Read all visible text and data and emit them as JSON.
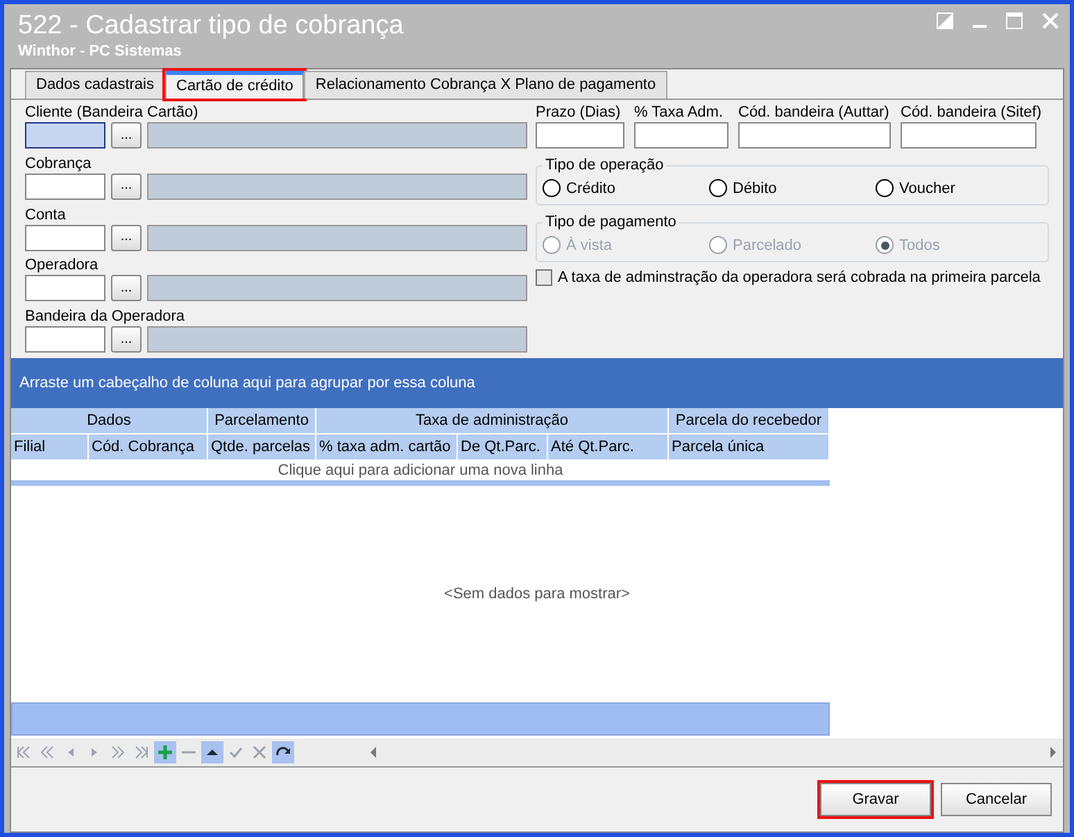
{
  "window": {
    "title": "522 - Cadastrar tipo de cobrança",
    "subtitle": "Winthor - PC Sistemas"
  },
  "tabs": [
    {
      "label": "Dados cadastrais",
      "selected": false,
      "highlighted": false
    },
    {
      "label": "Cartão de crédito",
      "selected": true,
      "highlighted": true
    },
    {
      "label": "Relacionamento Cobrança X Plano de pagamento",
      "selected": false,
      "highlighted": false
    }
  ],
  "lookups": [
    {
      "label": "Cliente (Bandeira Cartão)",
      "button": "...",
      "focused": true
    },
    {
      "label": "Cobrança",
      "button": "...",
      "focused": false
    },
    {
      "label": "Conta",
      "button": "...",
      "focused": false
    },
    {
      "label": "Operadora",
      "button": "...",
      "focused": false
    },
    {
      "label": "Bandeira da Operadora",
      "button": "...",
      "focused": false
    }
  ],
  "fields": [
    {
      "label": "Prazo (Dias)"
    },
    {
      "label": "% Taxa Adm."
    },
    {
      "label": "Cód. bandeira (Auttar)"
    },
    {
      "label": "Cód. bandeira (Sitef)"
    }
  ],
  "radio_groups": [
    {
      "title": "Tipo de operação",
      "disabled": false,
      "options": [
        {
          "label": "Crédito",
          "selected": false
        },
        {
          "label": "Débito",
          "selected": false
        },
        {
          "label": "Voucher",
          "selected": false
        }
      ]
    },
    {
      "title": "Tipo de pagamento",
      "disabled": true,
      "options": [
        {
          "label": "À vista",
          "selected": false
        },
        {
          "label": "Parcelado",
          "selected": false
        },
        {
          "label": "Todos",
          "selected": true
        }
      ]
    }
  ],
  "checkbox": {
    "label": "A taxa de adminstração da operadora será cobrada na primeira parcela",
    "checked": false
  },
  "grid": {
    "group_panel": "Arraste um cabeçalho de coluna aqui para agrupar por essa coluna",
    "bands": [
      {
        "label": "Dados"
      },
      {
        "label": "Parcelamento"
      },
      {
        "label": "Taxa de administração"
      },
      {
        "label": "Parcela do recebedor"
      }
    ],
    "columns": [
      "Filial",
      "Cód. Cobrança",
      "Qtde. parcelas",
      "% taxa adm. cartão",
      "De Qt.Parc.",
      "Até Qt.Parc.",
      "Parcela única"
    ],
    "new_row": "Clique aqui para adicionar uma nova linha",
    "empty": "<Sem dados para mostrar>",
    "nav_buttons": [
      {
        "kind": "first",
        "active": false
      },
      {
        "kind": "prev-page",
        "active": false
      },
      {
        "kind": "prev",
        "active": false
      },
      {
        "kind": "next",
        "active": false
      },
      {
        "kind": "next-page",
        "active": false
      },
      {
        "kind": "last",
        "active": false
      },
      {
        "kind": "add",
        "active": true
      },
      {
        "kind": "remove",
        "active": false
      },
      {
        "kind": "up",
        "active": true
      },
      {
        "kind": "confirm",
        "active": false
      },
      {
        "kind": "cancel",
        "active": false
      },
      {
        "kind": "refresh",
        "active": true
      }
    ]
  },
  "buttons": [
    {
      "label": "Gravar",
      "highlighted": true
    },
    {
      "label": "Cancelar",
      "highlighted": false
    }
  ]
}
